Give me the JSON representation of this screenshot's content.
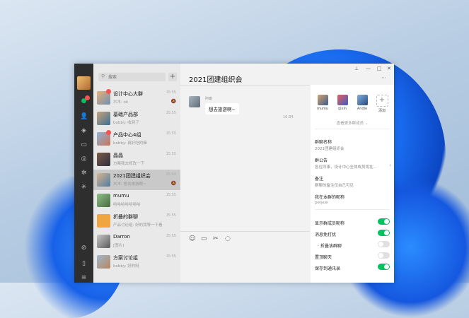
{
  "window": {
    "title": "2021团建组织会"
  },
  "search": {
    "placeholder": "搜索"
  },
  "chats": [
    {
      "name": "设计中心大群",
      "preview": "木木: ok",
      "time": "15:55",
      "badge": "",
      "muted": true
    },
    {
      "name": "基础产品部",
      "preview": "bobby: 收到了",
      "time": "15:55",
      "badge": "",
      "muted": false
    },
    {
      "name": "产品中心4组",
      "preview": "bobby: 真好吃的嘛",
      "time": "15:55",
      "badge": "",
      "muted": false
    },
    {
      "name": "晶晶",
      "preview": "方案我去修改一下",
      "time": "15:55",
      "badge": "",
      "muted": false
    },
    {
      "name": "2021团建组织会",
      "preview": "木木: 想去旅游啊~",
      "time": "15:54",
      "badge": "",
      "muted": true
    },
    {
      "name": "mumu",
      "preview": "哈哈哈哈哈哈哈",
      "time": "15:55",
      "badge": "",
      "muted": false
    },
    {
      "name": "折叠的群聊",
      "preview": "产品讨论组: 好的我等一下看",
      "time": "15:55",
      "badge": "",
      "muted": false
    },
    {
      "name": "Darron",
      "preview": "[图片]",
      "time": "15:55",
      "badge": "",
      "muted": false
    },
    {
      "name": "方案讨论组",
      "preview": "bobby: 好的呀",
      "time": "15:55",
      "badge": "",
      "muted": false
    }
  ],
  "conversation": {
    "sender": "阿秦",
    "message": "想去旅游啊~",
    "timestamp": "10:34"
  },
  "members": [
    {
      "name": "mumu"
    },
    {
      "name": "qixin"
    },
    {
      "name": "Andie"
    },
    {
      "name": "添加"
    }
  ],
  "members_more": "查看更多群成员",
  "panel": {
    "group_name_label": "群聊名称",
    "group_name_value": "2021团建组织会",
    "notice_label": "群公告",
    "notice_value": "各位同事，设计中心全体成员将在...",
    "remark_label": "备注",
    "remark_value": "群聊的备注仅自己可见",
    "nickname_label": "我在本群的昵称",
    "nickname_value": "peiyue",
    "toggles": [
      {
        "label": "显示群成员昵称",
        "on": true
      },
      {
        "label": "消息免打扰",
        "on": true
      },
      {
        "label": "折叠该群聊",
        "on": false
      },
      {
        "label": "置顶聊天",
        "on": false
      },
      {
        "label": "保存到通讯录",
        "on": true
      }
    ]
  },
  "colors": {
    "accent": "#07c160",
    "badge": "#fa5151"
  }
}
